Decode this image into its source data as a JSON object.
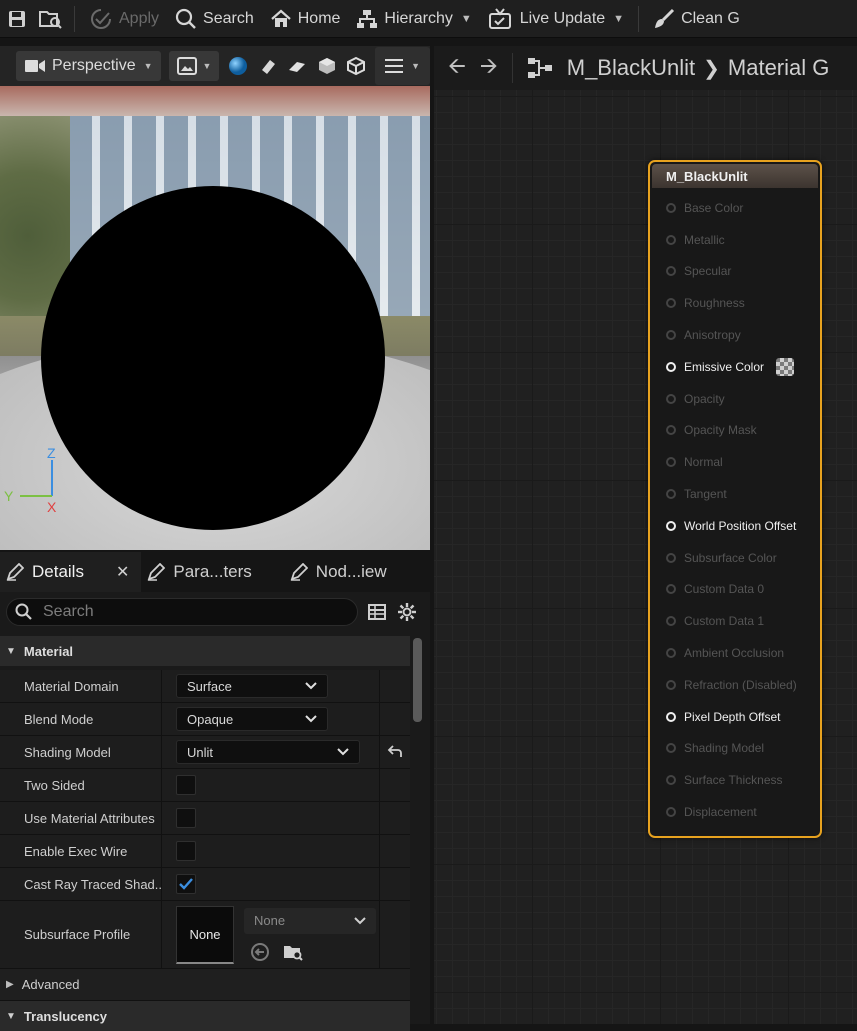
{
  "toolbar": {
    "apply_label": "Apply",
    "search_label": "Search",
    "home_label": "Home",
    "hierarchy_label": "Hierarchy",
    "live_update_label": "Live Update",
    "clean_label": "Clean G"
  },
  "viewport": {
    "view_mode": "Perspective",
    "axis": {
      "z": "Z",
      "y": "Y",
      "x": "X"
    }
  },
  "details": {
    "tabs": [
      {
        "label": "Details",
        "active": true
      },
      {
        "label": "Para...ters"
      },
      {
        "label": "Nod...iew"
      }
    ],
    "search_placeholder": "Search",
    "category_material": "Material",
    "rows": [
      {
        "label": "Material Domain",
        "value": "Surface"
      },
      {
        "label": "Blend Mode",
        "value": "Opaque"
      },
      {
        "label": "Shading Model",
        "value": "Unlit"
      },
      {
        "label": "Two Sided",
        "checked": false
      },
      {
        "label": "Use Material Attributes",
        "checked": false
      },
      {
        "label": "Enable Exec Wire",
        "checked": false
      },
      {
        "label": "Cast Ray Traced Shad...",
        "checked": true
      }
    ],
    "subsurface": {
      "label": "Subsurface Profile",
      "thumb": "None",
      "combo": "None"
    },
    "category_advanced": "Advanced",
    "category_translucency": "Translucency"
  },
  "graph": {
    "breadcrumb_asset": "M_BlackUnlit",
    "breadcrumb_graph": "Material G",
    "node": {
      "title": "M_BlackUnlit",
      "pins": [
        {
          "label": "Base Color",
          "active": false
        },
        {
          "label": "Metallic",
          "active": false
        },
        {
          "label": "Specular",
          "active": false
        },
        {
          "label": "Roughness",
          "active": false
        },
        {
          "label": "Anisotropy",
          "active": false
        },
        {
          "label": "Emissive Color",
          "active": true
        },
        {
          "label": "Opacity",
          "active": false
        },
        {
          "label": "Opacity Mask",
          "active": false
        },
        {
          "label": "Normal",
          "active": false
        },
        {
          "label": "Tangent",
          "active": false
        },
        {
          "label": "World Position Offset",
          "active": true
        },
        {
          "label": "Subsurface Color",
          "active": false
        },
        {
          "label": "Custom Data 0",
          "active": false
        },
        {
          "label": "Custom Data 1",
          "active": false
        },
        {
          "label": "Ambient Occlusion",
          "active": false
        },
        {
          "label": "Refraction (Disabled)",
          "active": false
        },
        {
          "label": "Pixel Depth Offset",
          "active": true
        },
        {
          "label": "Shading Model",
          "active": false
        },
        {
          "label": "Surface Thickness",
          "active": false
        },
        {
          "label": "Displacement",
          "active": false
        }
      ]
    }
  },
  "colors": {
    "accent": "#e7a21f",
    "check": "#3b8ee0"
  }
}
